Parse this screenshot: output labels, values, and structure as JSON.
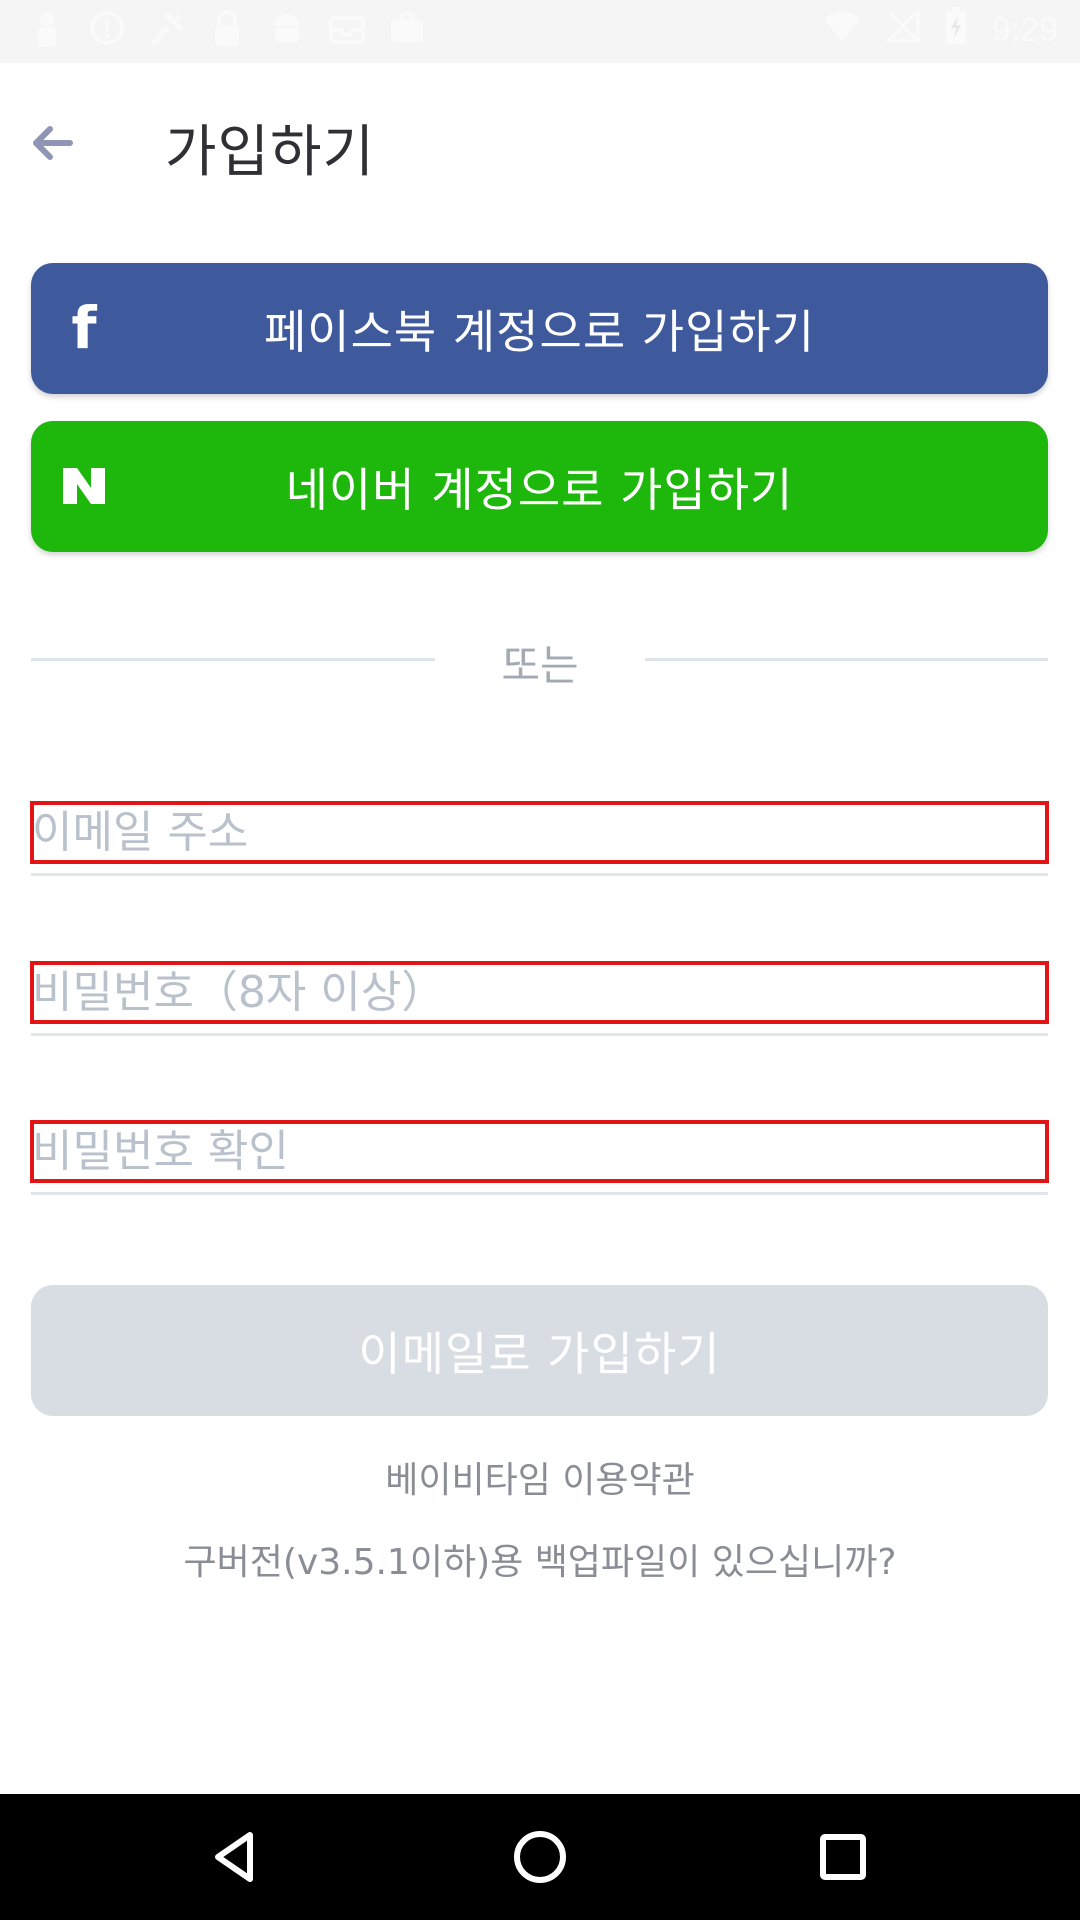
{
  "status_bar": {
    "time": "9:29",
    "left_icons": [
      "person-icon",
      "alert-icon",
      "tools-icon",
      "lock-icon",
      "android-icon",
      "inbox-icon",
      "briefcase-icon"
    ],
    "right_icons": [
      "wifi-icon",
      "no-signal-icon",
      "battery-charging-icon"
    ]
  },
  "header": {
    "title": "가입하기",
    "back_icon": "arrow-left-icon"
  },
  "social": {
    "facebook_label": "페이스북 계정으로 가입하기",
    "facebook_icon": "f",
    "facebook_color": "#3e5a9c",
    "naver_label": "네이버 계정으로 가입하기",
    "naver_icon": "N",
    "naver_color": "#1eb70b"
  },
  "divider": {
    "text": "또는"
  },
  "form": {
    "email_placeholder": "이메일 주소",
    "password_placeholder": "비밀번호（8자 이상）",
    "confirm_placeholder": "비밀번호 확인",
    "submit_label": "이메일로 가입하기",
    "highlight_color": "#e11515"
  },
  "links": {
    "terms": "베이비타임 이용약관",
    "backup": "구버전(v3.5.1이하)용 백업파일이 있으십니까?"
  },
  "nav": {
    "back_icon": "triangle-back-icon",
    "home_icon": "circle-home-icon",
    "recents_icon": "square-recents-icon"
  }
}
